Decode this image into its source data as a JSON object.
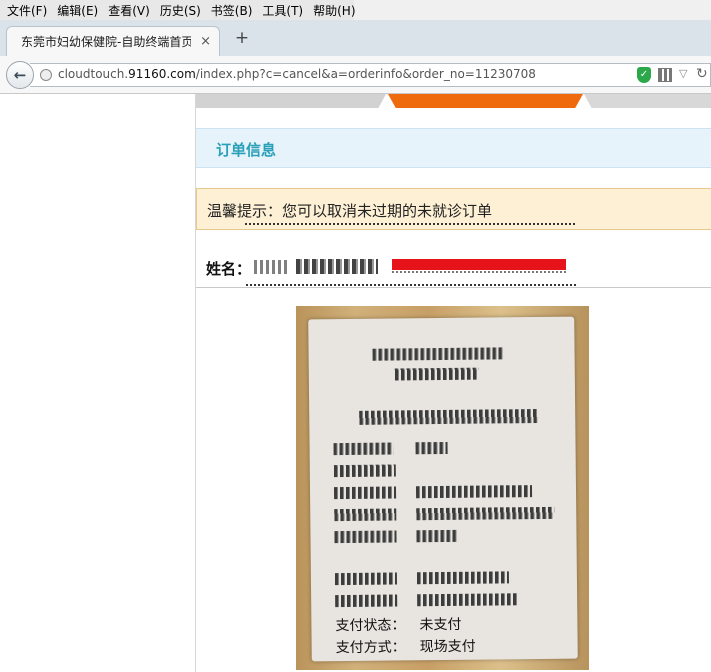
{
  "menu": [
    "文件(F)",
    "编辑(E)",
    "查看(V)",
    "历史(S)",
    "书签(B)",
    "工具(T)",
    "帮助(H)"
  ],
  "tab": {
    "title": "东莞市妇幼保健院-自助终端首页",
    "close": "×",
    "new_tab": "+"
  },
  "address": {
    "prefix": "cloudtouch.",
    "domain": "91160.com",
    "path": "/index.php?c=cancel&a=orderinfo&order_no=11230708"
  },
  "icons": {
    "back": "←",
    "shield": "✓",
    "dropdown": "▽",
    "reload": "↻"
  },
  "order": {
    "title": "订单信息",
    "tip": "温馨提示：您可以取消未过期的未就诊订单",
    "name_label": "姓名："
  },
  "ticket": {
    "payment_status_label": "支付状态：",
    "payment_status_value": "未支付",
    "payment_method_label": "支付方式：",
    "payment_method_value": "现场支付"
  },
  "colors": {
    "step_active": "#ef6a0c",
    "title_accent": "#2aa0b8",
    "redaction": "#e6141a"
  }
}
